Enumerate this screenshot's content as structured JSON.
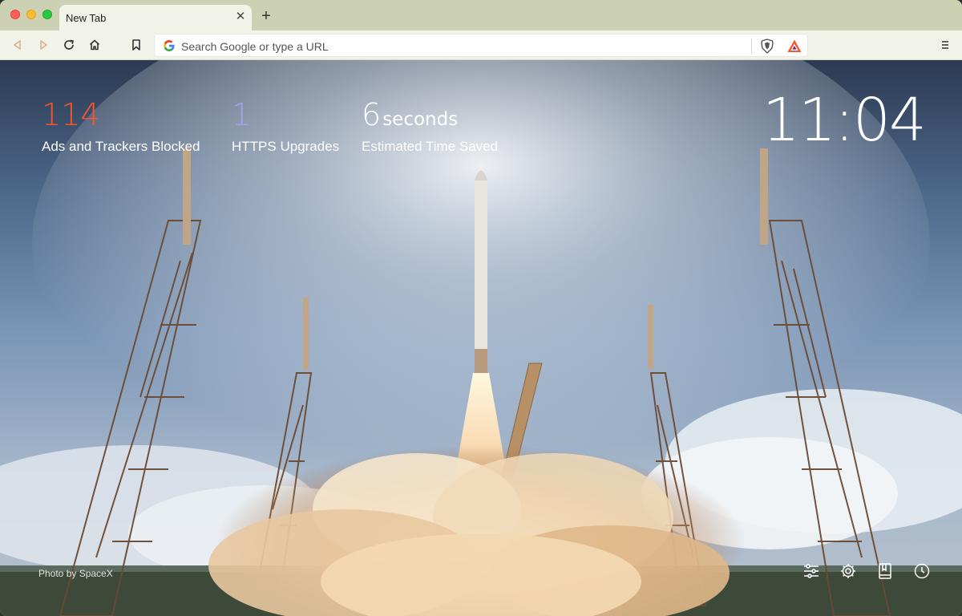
{
  "window": {
    "traffic_lights": [
      "close",
      "minimize",
      "maximize"
    ]
  },
  "tabs": [
    {
      "title": "New Tab",
      "active": true
    }
  ],
  "newtab_icon": "plus-icon",
  "toolbar": {
    "back_icon": "back-arrow-icon",
    "forward_icon": "forward-arrow-icon",
    "reload_icon": "reload-icon",
    "home_icon": "home-icon",
    "bookmark_icon": "bookmark-icon",
    "menu_icon": "hamburger-menu-icon"
  },
  "omnibox": {
    "placeholder": "Search Google or type a URL",
    "value": ""
  },
  "newtab": {
    "stats": [
      {
        "value": "114",
        "unit": "",
        "label": "Ads and Trackers Blocked",
        "color": "#fb542b"
      },
      {
        "value": "1",
        "unit": "",
        "label": "HTTPS Upgrades",
        "color": "#a0a5eb"
      },
      {
        "value": "6",
        "unit": "seconds",
        "label": "Estimated Time Saved",
        "color": "#ffffff"
      }
    ],
    "clock": "11:04",
    "photo_credit": "Photo by SpaceX",
    "dock": [
      {
        "name": "customize-icon"
      },
      {
        "name": "settings-icon"
      },
      {
        "name": "bookmarks-icon"
      },
      {
        "name": "history-icon"
      }
    ]
  },
  "colors": {
    "accent": "#fb542b",
    "toolbar_bg": "#f1f2e8",
    "tabstrip_bg": "#cdd1b4"
  }
}
